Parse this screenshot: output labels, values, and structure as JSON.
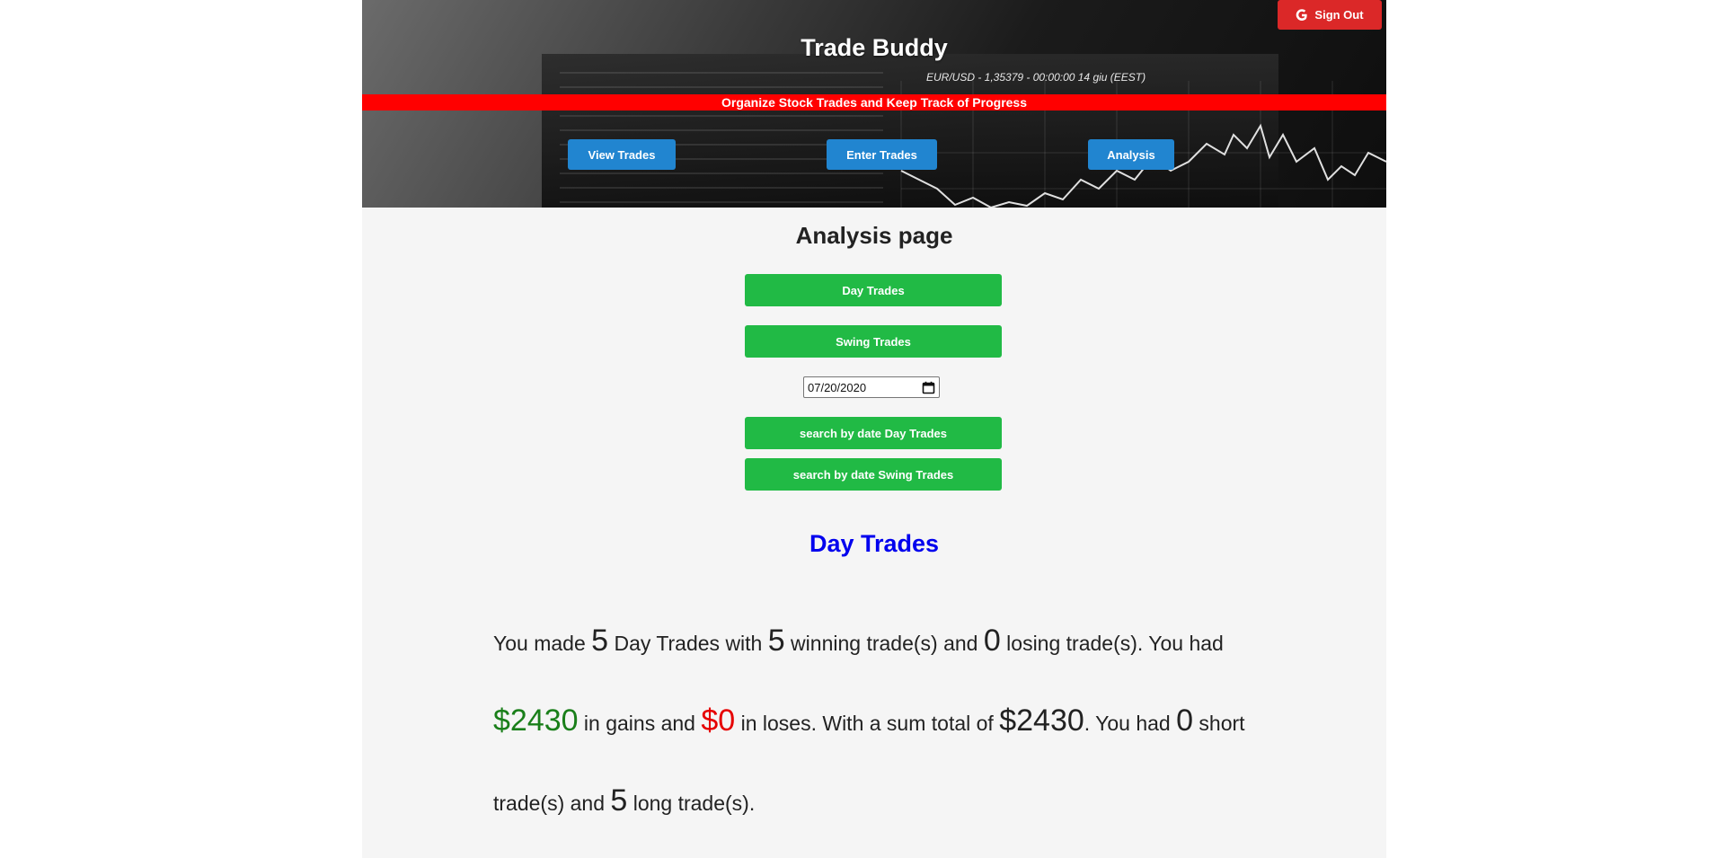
{
  "header": {
    "title": "Trade Buddy",
    "tagline": "Organize Stock Trades and Keep Track of Progress",
    "ticker_text": "EUR/USD - 1,35379 - 00:00:00  14 giu (EEST)",
    "signout_label": "Sign Out",
    "nav": {
      "view_trades": "View Trades",
      "enter_trades": "Enter Trades",
      "analysis": "Analysis"
    }
  },
  "main": {
    "title": "Analysis page",
    "buttons": {
      "day_trades": "Day Trades",
      "swing_trades": "Swing Trades",
      "search_day": "search by date Day Trades",
      "search_swing": "search by date Swing Trades"
    },
    "date_value": "07/20/2020",
    "section_title": "Day Trades",
    "summary": {
      "t1": "You made ",
      "total_trades": "5",
      "t2": " Day Trades with ",
      "winning": "5",
      "t3": " winning trade(s) and ",
      "losing": "0",
      "t4": " losing trade(s). You had ",
      "gains": "$2430",
      "t5": " in gains and ",
      "loses": "$0",
      "t6": " in loses. With a sum total of ",
      "sum_total": "$2430",
      "t7": ". You had ",
      "short": "0",
      "t8": " short trade(s) and ",
      "long": "5",
      "t9": " long trade(s)."
    }
  },
  "colors": {
    "nav_button": "#2185d0",
    "green_button": "#21ba45",
    "signout": "#db2828",
    "banner": "#ff0000",
    "section_title": "#0000ee",
    "gain": "#1a7f1a",
    "lose": "#e60000"
  },
  "icons": {
    "signout": "google-icon",
    "date": "calendar-icon"
  }
}
